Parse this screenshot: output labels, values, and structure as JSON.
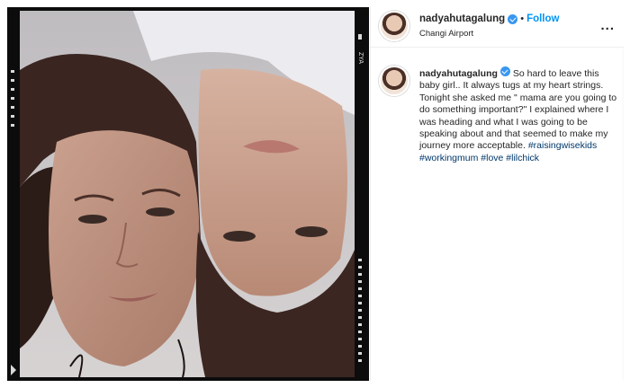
{
  "post": {
    "username": "nadyahutagalung",
    "separator": "•",
    "follow_label": "Follow",
    "location": "Changi Airport",
    "more_label": "...",
    "caption_text": "So hard to leave this baby girl.. It always tugs at my heart strings. Tonight she asked me \" mama are you going to do something important?\" I explained where I was heading and what I was going to be speaking about and that seemed to make my journey more acceptable.",
    "hashtags": "#raisingwisekids #workingmum #love #lilchick"
  },
  "photo": {
    "film_mark": "ZYA"
  },
  "colors": {
    "accent_blue": "#0095f6",
    "verified_blue": "#3897f0",
    "hashtag_blue": "#00376b",
    "text": "#262626",
    "border": "#efefef"
  },
  "icons": [
    "verified-badge-icon",
    "more-options-icon",
    "avatar"
  ]
}
